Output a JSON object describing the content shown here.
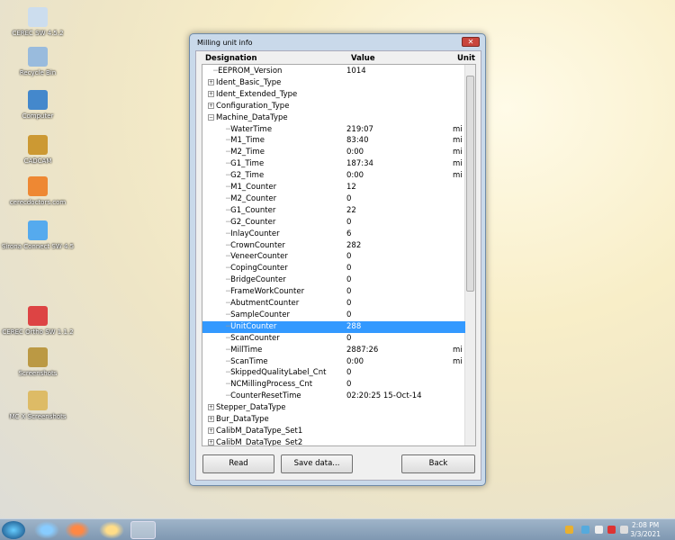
{
  "desktop": [
    "CEREC SW 4.5.2",
    "Recycle Bin",
    "Computer",
    "CADCAM",
    "cerecdoctors.com",
    "Sirona Connect SW 4.5",
    "CEREC Ortho SW 1.1.2",
    "Screenshots",
    "MC X Screenshots"
  ],
  "window": {
    "title": "Milling unit info",
    "close": "✕"
  },
  "headers": {
    "designation": "Designation",
    "value": "Value",
    "unit": "Unit"
  },
  "rows": [
    {
      "name": "EEPROM_Version",
      "value": "1014",
      "unit": "",
      "level": 0,
      "exp": ""
    },
    {
      "name": "Ident_Basic_Type",
      "value": "",
      "unit": "",
      "level": 0,
      "exp": "+"
    },
    {
      "name": "Ident_Extended_Type",
      "value": "",
      "unit": "",
      "level": 0,
      "exp": "+"
    },
    {
      "name": "Configuration_Type",
      "value": "",
      "unit": "",
      "level": 0,
      "exp": "+"
    },
    {
      "name": "Machine_DataType",
      "value": "",
      "unit": "",
      "level": 0,
      "exp": "−"
    },
    {
      "name": "WaterTime",
      "value": "219:07",
      "unit": "mi",
      "level": 1
    },
    {
      "name": "M1_Time",
      "value": "83:40",
      "unit": "mi",
      "level": 1
    },
    {
      "name": "M2_Time",
      "value": "0:00",
      "unit": "mi",
      "level": 1
    },
    {
      "name": "G1_Time",
      "value": "187:34",
      "unit": "mi",
      "level": 1
    },
    {
      "name": "G2_Time",
      "value": "0:00",
      "unit": "mi",
      "level": 1
    },
    {
      "name": "M1_Counter",
      "value": "12",
      "unit": "",
      "level": 1
    },
    {
      "name": "M2_Counter",
      "value": "0",
      "unit": "",
      "level": 1
    },
    {
      "name": "G1_Counter",
      "value": "22",
      "unit": "",
      "level": 1
    },
    {
      "name": "G2_Counter",
      "value": "0",
      "unit": "",
      "level": 1
    },
    {
      "name": "InlayCounter",
      "value": "6",
      "unit": "",
      "level": 1
    },
    {
      "name": "CrownCounter",
      "value": "282",
      "unit": "",
      "level": 1
    },
    {
      "name": "VeneerCounter",
      "value": "0",
      "unit": "",
      "level": 1
    },
    {
      "name": "CopingCounter",
      "value": "0",
      "unit": "",
      "level": 1
    },
    {
      "name": "BridgeCounter",
      "value": "0",
      "unit": "",
      "level": 1
    },
    {
      "name": "FrameWorkCounter",
      "value": "0",
      "unit": "",
      "level": 1
    },
    {
      "name": "AbutmentCounter",
      "value": "0",
      "unit": "",
      "level": 1
    },
    {
      "name": "SampleCounter",
      "value": "0",
      "unit": "",
      "level": 1
    },
    {
      "name": "UnitCounter",
      "value": "288",
      "unit": "",
      "level": 1,
      "selected": true
    },
    {
      "name": "ScanCounter",
      "value": "0",
      "unit": "",
      "level": 1
    },
    {
      "name": "MillTime",
      "value": "2887:26",
      "unit": "mi",
      "level": 1
    },
    {
      "name": "ScanTime",
      "value": "0:00",
      "unit": "mi",
      "level": 1
    },
    {
      "name": "SkippedQualityLabel_Cnt",
      "value": "0",
      "unit": "",
      "level": 1
    },
    {
      "name": "NCMillingProcess_Cnt",
      "value": "0",
      "unit": "",
      "level": 1
    },
    {
      "name": "CounterResetTime",
      "value": "02:20:25 15-Oct-14",
      "unit": "",
      "level": 1
    },
    {
      "name": "Stepper_DataType",
      "value": "",
      "unit": "",
      "level": 0,
      "exp": "+"
    },
    {
      "name": "Bur_DataType",
      "value": "",
      "unit": "",
      "level": 0,
      "exp": "+"
    },
    {
      "name": "CalibM_DataType_Set1",
      "value": "",
      "unit": "",
      "level": 0,
      "exp": "+"
    },
    {
      "name": "CalibM_DataType_Set2",
      "value": "",
      "unit": "",
      "level": 0,
      "exp": "+"
    }
  ],
  "buttons": {
    "read": "Read",
    "save": "Save data...",
    "back": "Back"
  },
  "clock": {
    "time": "2:08 PM",
    "date": "3/3/2021"
  }
}
